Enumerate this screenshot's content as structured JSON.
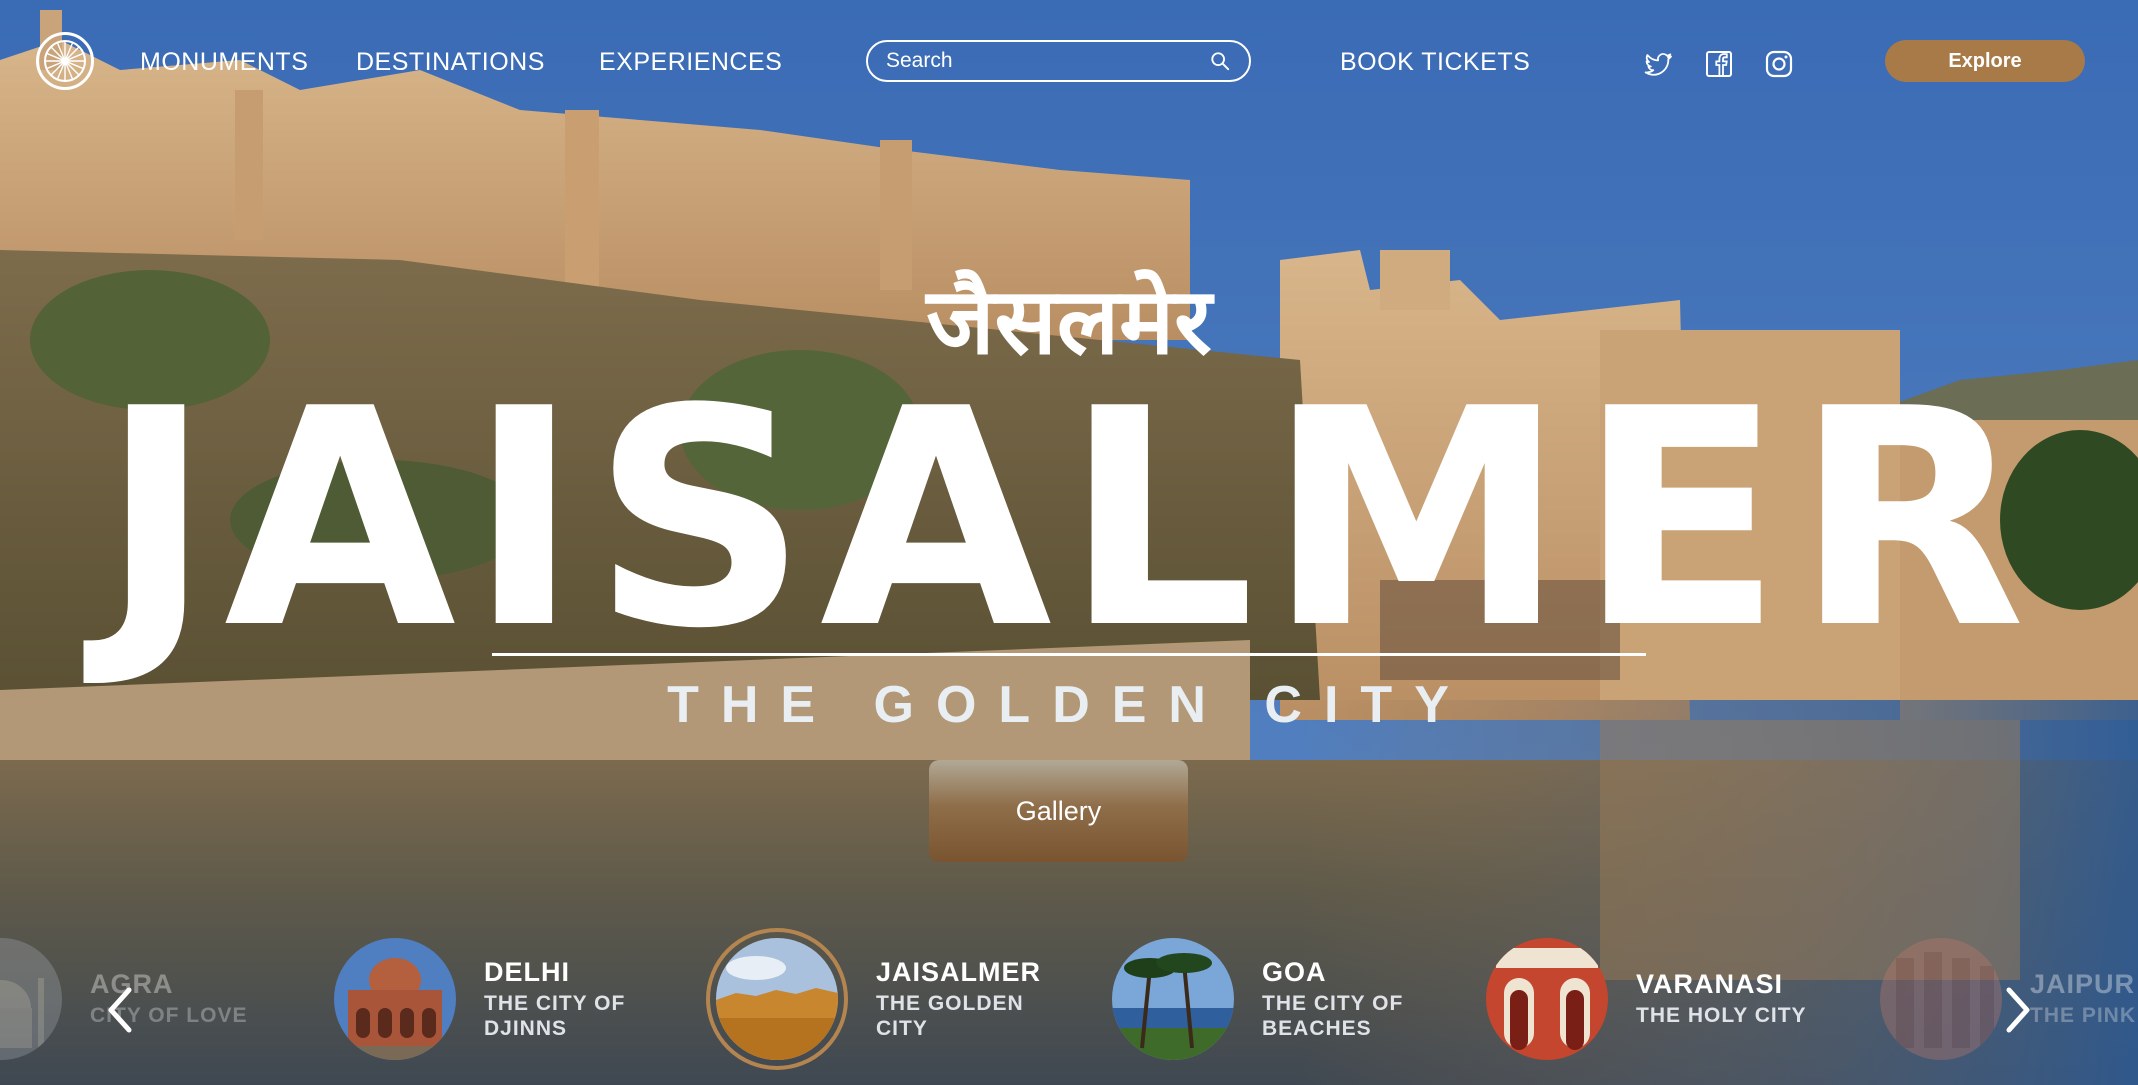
{
  "nav": {
    "links": [
      "MONUMENTS",
      "DESTINATIONS",
      "EXPERIENCES"
    ],
    "search_placeholder": "Search",
    "book_tickets": "BOOK TICKETS",
    "explore": "Explore",
    "social_icons": [
      "twitter-icon",
      "facebook-icon",
      "instagram-icon"
    ],
    "logo_icon": "ashoka-chakra-icon"
  },
  "hero": {
    "hindi_title": "जैसलमेर",
    "title": "JAISALMER",
    "subtitle": "THE GOLDEN CITY",
    "gallery_button": "Gallery"
  },
  "carousel": {
    "prev_icon": "chevron-left-icon",
    "next_icon": "chevron-right-icon",
    "items": [
      {
        "name": "AGRA",
        "tagline": "CITY OF LOVE",
        "state": "faded"
      },
      {
        "name": "DELHI",
        "tagline": "THE CITY OF DJINNS",
        "state": "normal"
      },
      {
        "name": "JAISALMER",
        "tagline": "THE GOLDEN CITY",
        "state": "active"
      },
      {
        "name": "GOA",
        "tagline": "THE CITY OF BEACHES",
        "state": "normal"
      },
      {
        "name": "VARANASI",
        "tagline": "THE HOLY CITY",
        "state": "normal"
      },
      {
        "name": "JAIPUR",
        "tagline": "THE PINK",
        "state": "faded"
      }
    ]
  },
  "colors": {
    "accent": "#a87a48",
    "active_ring": "#b58550",
    "sky": "#3f6fb3"
  }
}
